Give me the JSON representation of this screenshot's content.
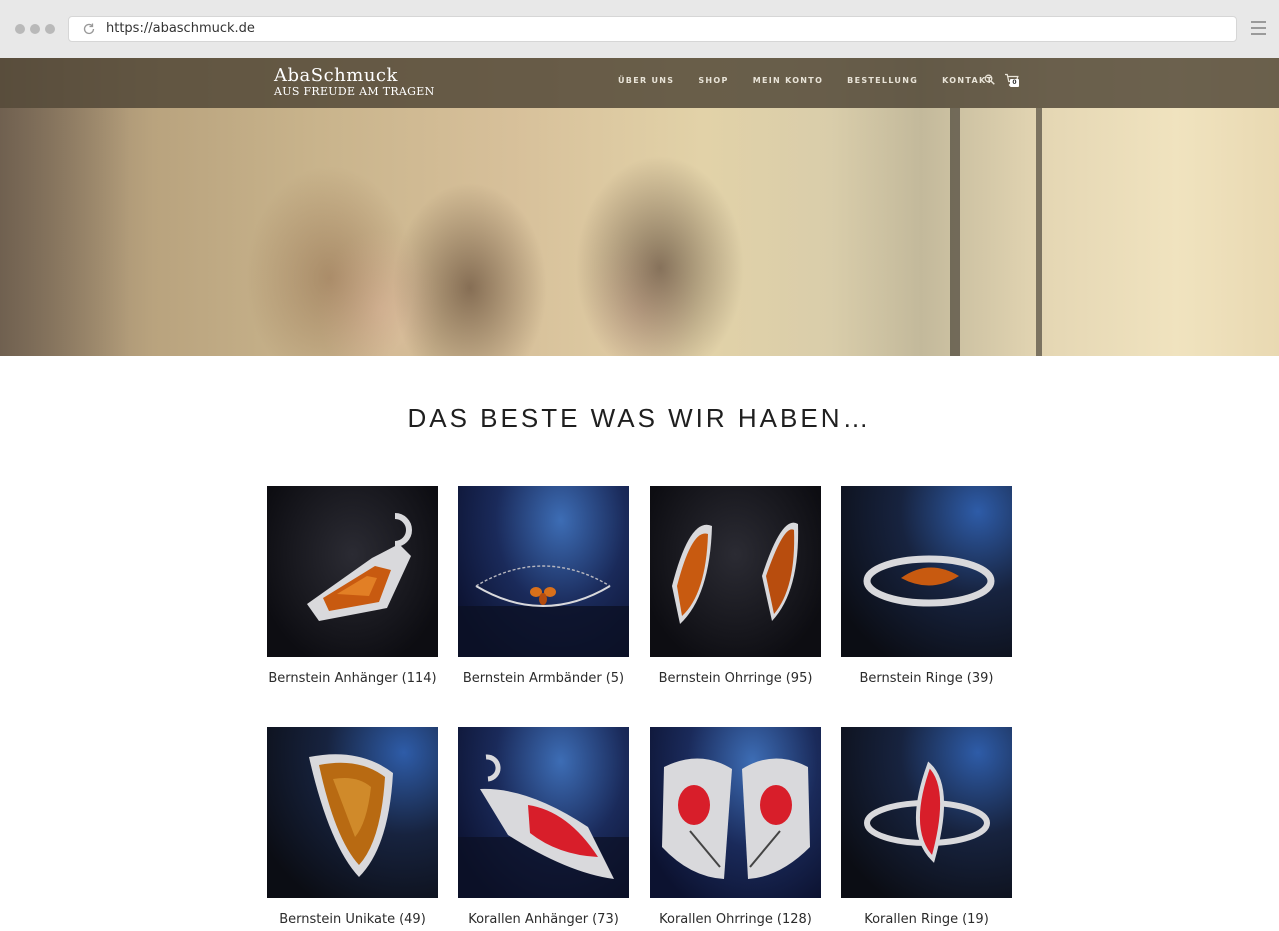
{
  "browser": {
    "url": "https://abaschmuck.de"
  },
  "nav": {
    "logo_main": "AbaSchmuck",
    "logo_sub": "AUS FREUDE AM TRAGEN",
    "items": [
      {
        "label": "ÜBER UNS"
      },
      {
        "label": "SHOP"
      },
      {
        "label": "MEIN KONTO"
      },
      {
        "label": "BESTELLUNG"
      },
      {
        "label": "KONTAKT"
      }
    ],
    "cart_count": "0"
  },
  "main": {
    "title": "DAS BESTE WAS WIR HABEN…",
    "categories": [
      {
        "name": "Bernstein Anhänger",
        "count": "(114)",
        "image": "amber-pendant"
      },
      {
        "name": "Bernstein Armbänder",
        "count": "(5)",
        "image": "amber-bracelet"
      },
      {
        "name": "Bernstein Ohrringe",
        "count": "(95)",
        "image": "amber-earrings"
      },
      {
        "name": "Bernstein Ringe",
        "count": "(39)",
        "image": "amber-ring"
      },
      {
        "name": "Bernstein Unikate",
        "count": "(49)",
        "image": "amber-unique-ring"
      },
      {
        "name": "Korallen Anhänger",
        "count": "(73)",
        "image": "coral-pendant"
      },
      {
        "name": "Korallen Ohrringe",
        "count": "(128)",
        "image": "coral-earrings"
      },
      {
        "name": "Korallen Ringe",
        "count": "(19)",
        "image": "coral-ring"
      }
    ]
  },
  "colors": {
    "amber": "#c85a10",
    "coral": "#d81e2a",
    "silver": "#d9d9dc"
  }
}
